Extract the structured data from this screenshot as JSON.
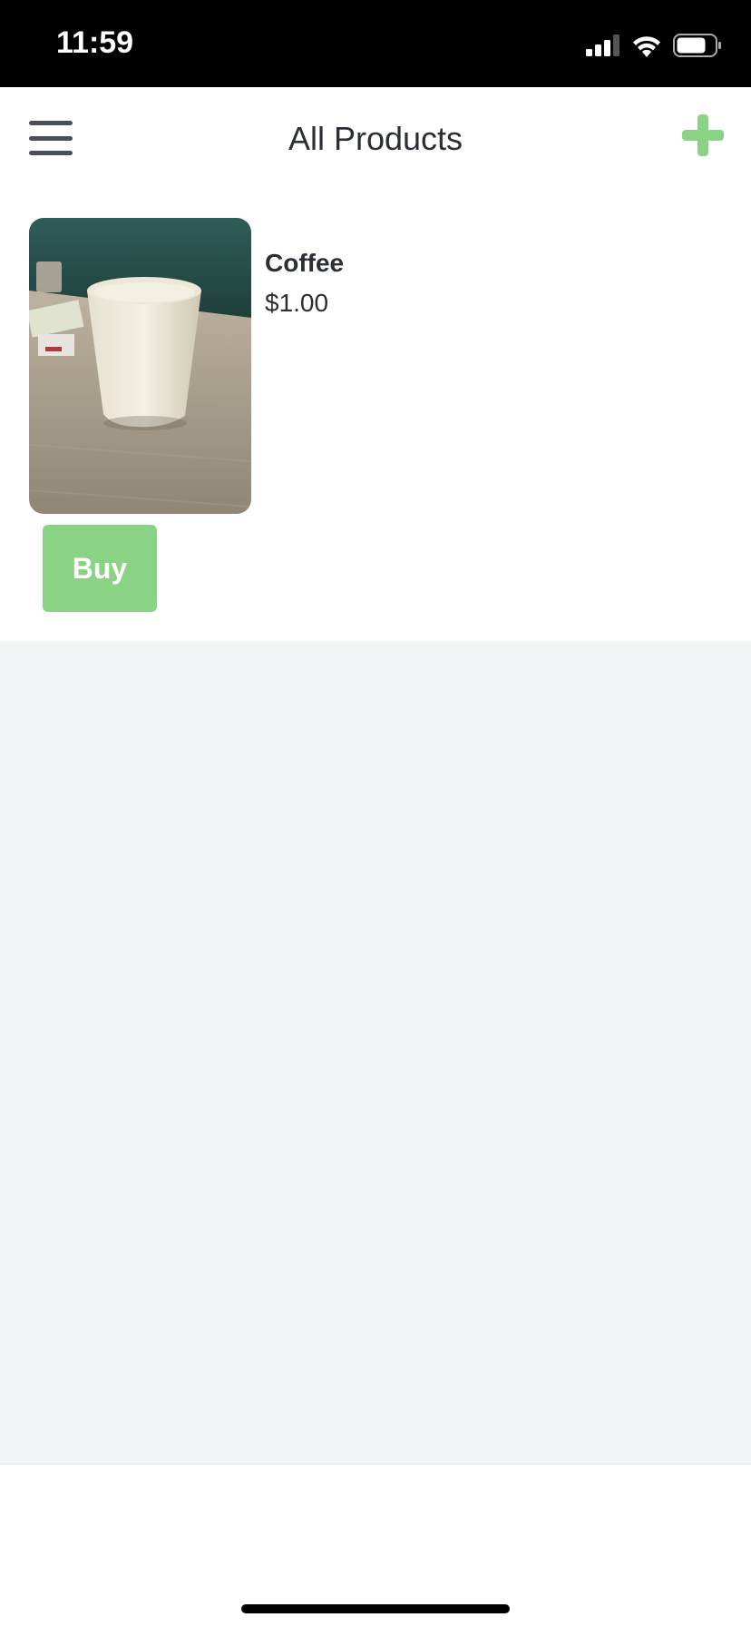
{
  "status_bar": {
    "time": "11:59",
    "icons": [
      "cellular-signal-icon",
      "wifi-icon",
      "battery-icon"
    ]
  },
  "header": {
    "title": "All Products",
    "menu_icon": "hamburger-menu-icon",
    "add_icon": "plus-icon"
  },
  "products": [
    {
      "name": "Coffee",
      "price": "$1.00",
      "buy_label": "Buy"
    }
  ],
  "colors": {
    "accent_green": "#8bd384",
    "text_dark": "#2b2f35",
    "background": "#f3f4f6"
  }
}
